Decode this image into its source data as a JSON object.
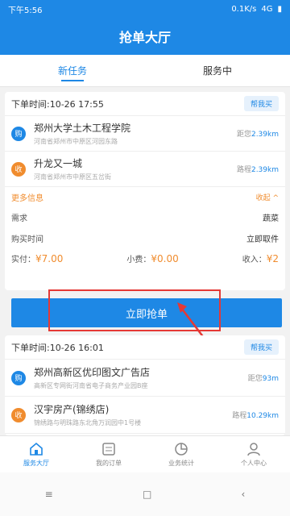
{
  "status": {
    "time": "下午5:56",
    "network": "0.1K/s",
    "signal": "4G"
  },
  "title": "抢单大厅",
  "tabs": [
    {
      "label": "新任务"
    },
    {
      "label": "服务中"
    }
  ],
  "orders": [
    {
      "time_label": "下单时间:10-26 17:55",
      "help_label": "帮我买",
      "pickup": {
        "badge": "购",
        "name": "郑州大学土木工程学院",
        "sub": "河南省郑州市中原区河园东路",
        "dist_label": "距您",
        "dist": "2.39km"
      },
      "dropoff": {
        "badge": "收",
        "name": "升龙又一城",
        "sub": "河南省郑州市中原区五岔街",
        "dist_label": "路程",
        "dist": "2.39km"
      },
      "more_label": "更多信息",
      "collapse_label": "收起 ^",
      "info": [
        {
          "k": "需求",
          "v": "蔬菜"
        },
        {
          "k": "购买时间",
          "v": "立即取件"
        }
      ],
      "pay": {
        "actual_label": "实付：",
        "actual": "¥7.00",
        "tip_label": "小费：",
        "tip": "¥0.00",
        "income_label": "收入：",
        "income": "¥2"
      }
    },
    {
      "time_label": "下单时间:10-26 16:01",
      "help_label": "帮我买",
      "pickup": {
        "badge": "购",
        "name": "郑州高新区优印图文广告店",
        "sub": "高新区专网街河南省电子商务产业园B座",
        "dist_label": "距您",
        "dist": "93m"
      },
      "dropoff": {
        "badge": "收",
        "name": "汉宇房产(锦绣店)",
        "sub": "锦绣路与明珠路东北角万润园中1号楼",
        "dist_label": "路程",
        "dist": "10.29km"
      }
    }
  ],
  "grab_button": "立即抢单",
  "bottom_nav": [
    {
      "label": "服务大厅",
      "icon": "home-icon"
    },
    {
      "label": "我的订单",
      "icon": "order-icon"
    },
    {
      "label": "业务统计",
      "icon": "chart-icon"
    },
    {
      "label": "个人中心",
      "icon": "user-icon"
    }
  ],
  "colors": {
    "primary": "#1e88e5",
    "accent": "#f08c2e",
    "highlight": "#e53935"
  }
}
